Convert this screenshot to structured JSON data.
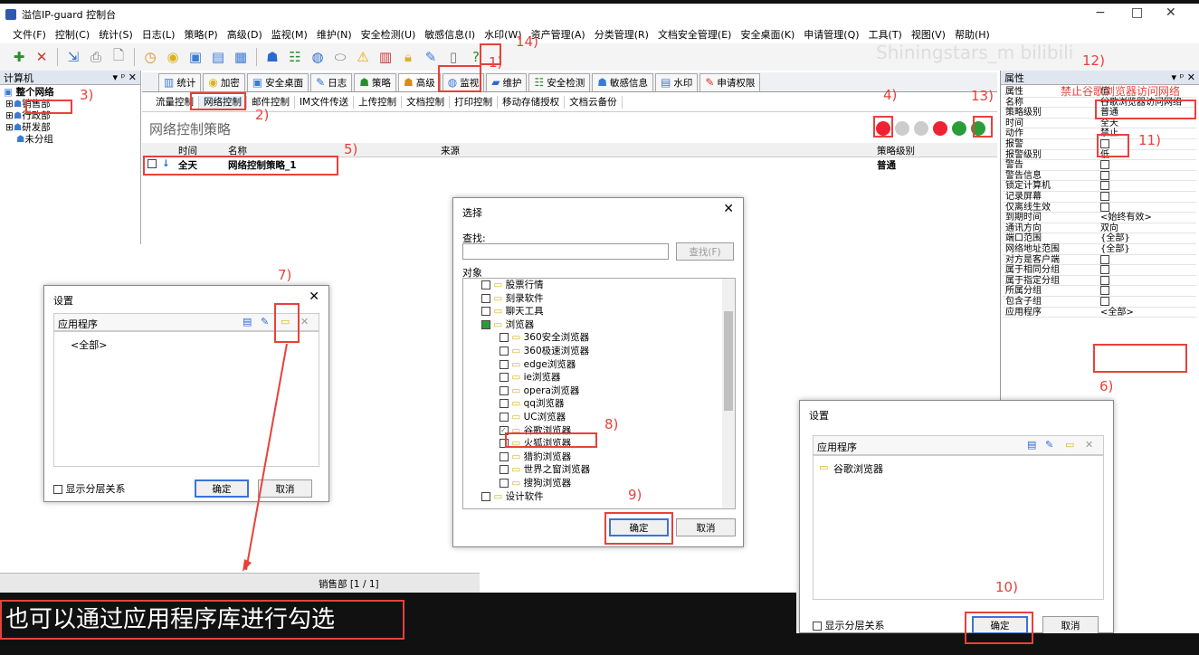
{
  "window": {
    "title": "溢信IP-guard 控制台",
    "min": "−",
    "max": "□",
    "close": "✕"
  },
  "menu": [
    "文件(F)",
    "控制(C)",
    "统计(S)",
    "日志(L)",
    "策略(P)",
    "高级(D)",
    "监视(M)",
    "维护(N)",
    "安全检测(U)",
    "敏感信息(I)",
    "水印(W)",
    "资产管理(A)",
    "分类管理(R)",
    "文档安全管理(E)",
    "安全桌面(K)",
    "申请管理(Q)",
    "工具(T)",
    "视图(V)",
    "帮助(H)"
  ],
  "watermark": "Shiningstars_m bilibili",
  "left_panel": {
    "title": "计算机",
    "controls": "▾ ᵖ ✕",
    "tree": [
      "整个网络",
      "销售部",
      "行政部",
      "研发部",
      "未分组"
    ]
  },
  "tabs": [
    "统计",
    "加密",
    "安全桌面",
    "日志",
    "策略",
    "高级",
    "监视",
    "维护",
    "安全检测",
    "敏感信息",
    "水印",
    "申请权限"
  ],
  "subtabs": [
    "流量控制",
    "网络控制",
    "邮件控制",
    "IM文件传送",
    "上传控制",
    "文档控制",
    "打印控制",
    "移动存储授权",
    "文档云备份"
  ],
  "page_title": "网络控制策略",
  "table": {
    "headers": [
      "时间",
      "名称",
      "来源",
      "策略级别"
    ],
    "row": {
      "time": "全天",
      "name": "网络控制策略_1",
      "source": "",
      "level": "普通"
    }
  },
  "props": {
    "title": "属性",
    "controls": "▾ ᵖ ✕",
    "rows": [
      {
        "k": "属性",
        "v": "值"
      },
      {
        "k": "名称",
        "v": "谷歌浏览器访问网络"
      },
      {
        "k": "策略级别",
        "v": "普通"
      },
      {
        "k": "时间",
        "v": "全天"
      },
      {
        "k": "动作",
        "v": "禁止"
      },
      {
        "k": "报警",
        "v": ""
      },
      {
        "k": "报警级别",
        "v": "低"
      },
      {
        "k": "警告",
        "v": ""
      },
      {
        "k": "警告信息",
        "v": ""
      },
      {
        "k": "锁定计算机",
        "v": ""
      },
      {
        "k": "记录屏幕",
        "v": ""
      },
      {
        "k": "仅离线生效",
        "v": ""
      },
      {
        "k": "到期时间",
        "v": "<始终有效>"
      },
      {
        "k": "通讯方向",
        "v": "双向"
      },
      {
        "k": "端口范围",
        "v": "{全部}"
      },
      {
        "k": "网络地址范围",
        "v": "{全部}"
      },
      {
        "k": "对方是客户端",
        "v": ""
      },
      {
        "k": "属于相同分组",
        "v": ""
      },
      {
        "k": "属于指定分组",
        "v": ""
      },
      {
        "k": "所属分组",
        "v": ""
      },
      {
        "k": "包含子组",
        "v": ""
      },
      {
        "k": "应用程序",
        "v": "<全部>"
      }
    ]
  },
  "dialog_settings1": {
    "title": "设置",
    "close": "✕",
    "label": "应用程序",
    "item": "<全部>",
    "show_hier": "显示分层关系",
    "ok": "确定",
    "cancel": "取消"
  },
  "dialog_select": {
    "title": "选择",
    "close": "✕",
    "find_label": "查找:",
    "find_btn": "查找(F)",
    "obj_label": "对象",
    "items": [
      "股票行情",
      "刻录软件",
      "聊天工具",
      "浏览器",
      "360安全浏览器",
      "360极速浏览器",
      "edge浏览器",
      "ie浏览器",
      "opera浏览器",
      "qq浏览器",
      "UC浏览器",
      "谷歌浏览器",
      "火狐浏览器",
      "猎豹浏览器",
      "世界之窗浏览器",
      "搜狗浏览器",
      "设计软件"
    ],
    "ok": "确定",
    "cancel": "取消"
  },
  "dialog_settings2": {
    "title": "设置",
    "close": "✕",
    "label": "应用程序",
    "item": "谷歌浏览器",
    "show_hier": "显示分层关系",
    "ok": "确定",
    "cancel": "取消"
  },
  "status": {
    "dept": "销售部 [1 / 1]"
  },
  "caption": "也可以通过应用程序库进行勾选",
  "annotations": {
    "a1": "1)",
    "a2": "2)",
    "a3": "3)",
    "a4": "4)",
    "a5": "5)",
    "a6": "6)",
    "a7": "7)",
    "a8": "8)",
    "a9": "9)",
    "a10": "10)",
    "a11": "11)",
    "a12": "12)",
    "a13": "13)",
    "a14": "14)",
    "name_hint": "禁止谷歌浏览器访问网络"
  },
  "colors": {
    "accent": "#e8413a",
    "blue": "#3b73d9"
  }
}
